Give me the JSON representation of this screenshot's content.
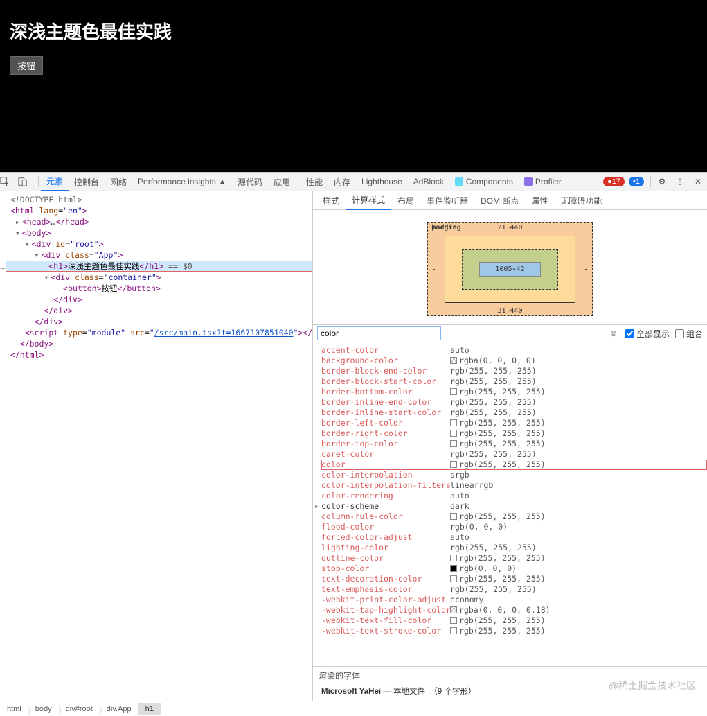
{
  "app": {
    "heading": "深浅主题色最佳实践",
    "button_label": "按钮"
  },
  "toolbar": {
    "tabs": [
      "元素",
      "控制台",
      "网络",
      "Performance insights ▲",
      "源代码",
      "应用",
      "性能",
      "内存",
      "Lighthouse",
      "AdBlock",
      "Components",
      "Profiler"
    ],
    "active_tab_index": 0,
    "error_count": "17",
    "message_count": "1"
  },
  "dom": {
    "doctype": "<!DOCTYPE html>",
    "html_open": "<html lang=\"en\">",
    "head": "<head>…</head>",
    "body_open": "<body>",
    "div_root": "<div id=\"root\">",
    "div_app": "<div class=\"App\">",
    "h1_line": "<h1>深浅主题色最佳实践</h1>",
    "eq0": " == $0",
    "div_container": "<div class=\"container\">",
    "button_line": "<button>按钮</button>",
    "div_close": "</div>",
    "script_prefix": "<script type=\"module\" src=\"",
    "script_src": "/src/main.tsx?t=1667107851040",
    "script_suffix": "\"></script>",
    "body_close": "</body>",
    "html_close": "</html>"
  },
  "styles_tabs": {
    "items": [
      "样式",
      "计算样式",
      "布局",
      "事件监听器",
      "DOM 断点",
      "属性",
      "无障碍功能"
    ],
    "active": 1
  },
  "boxmodel": {
    "margin_label": "margin",
    "border_label": "border",
    "padding_label": "padding",
    "margin_top": "21.440",
    "margin_bottom": "21.440",
    "margin_left": "-",
    "margin_right": "-",
    "border_all": "-",
    "padding_all": "-",
    "content": "1005×42"
  },
  "filter": {
    "value": "color",
    "show_all": "全部显示",
    "group": "组合"
  },
  "props": [
    {
      "name": "accent-color",
      "value": "auto",
      "swatch": null
    },
    {
      "name": "background-color",
      "value": "rgba(0, 0, 0, 0)",
      "swatch": "transparent"
    },
    {
      "name": "border-block-end-color",
      "value": "rgb(255, 255, 255)",
      "swatch": null
    },
    {
      "name": "border-block-start-color",
      "value": "rgb(255, 255, 255)",
      "swatch": null
    },
    {
      "name": "border-bottom-color",
      "value": "rgb(255, 255, 255)",
      "swatch": "#fff"
    },
    {
      "name": "border-inline-end-color",
      "value": "rgb(255, 255, 255)",
      "swatch": null
    },
    {
      "name": "border-inline-start-color",
      "value": "rgb(255, 255, 255)",
      "swatch": null
    },
    {
      "name": "border-left-color",
      "value": "rgb(255, 255, 255)",
      "swatch": "#fff"
    },
    {
      "name": "border-right-color",
      "value": "rgb(255, 255, 255)",
      "swatch": "#fff"
    },
    {
      "name": "border-top-color",
      "value": "rgb(255, 255, 255)",
      "swatch": "#fff"
    },
    {
      "name": "caret-color",
      "value": "rgb(255, 255, 255)",
      "swatch": null
    },
    {
      "name": "color",
      "value": "rgb(255, 255, 255)",
      "swatch": "#fff",
      "hl": true
    },
    {
      "name": "color-interpolation",
      "value": "srgb",
      "swatch": null
    },
    {
      "name": "color-interpolation-filters",
      "value": "linearrgb",
      "swatch": null
    },
    {
      "name": "color-rendering",
      "value": "auto",
      "swatch": null
    },
    {
      "name": "color-scheme",
      "value": "dark",
      "swatch": null,
      "bold": true,
      "arrow": true
    },
    {
      "name": "column-rule-color",
      "value": "rgb(255, 255, 255)",
      "swatch": "#fff"
    },
    {
      "name": "flood-color",
      "value": "rgb(0, 0, 0)",
      "swatch": null
    },
    {
      "name": "forced-color-adjust",
      "value": "auto",
      "swatch": null
    },
    {
      "name": "lighting-color",
      "value": "rgb(255, 255, 255)",
      "swatch": null
    },
    {
      "name": "outline-color",
      "value": "rgb(255, 255, 255)",
      "swatch": "#fff"
    },
    {
      "name": "stop-color",
      "value": "rgb(0, 0, 0)",
      "swatch": "#000"
    },
    {
      "name": "text-decoration-color",
      "value": "rgb(255, 255, 255)",
      "swatch": "#fff"
    },
    {
      "name": "text-emphasis-color",
      "value": "rgb(255, 255, 255)",
      "swatch": null
    },
    {
      "name": "-webkit-print-color-adjust",
      "value": "economy",
      "swatch": null
    },
    {
      "name": "-webkit-tap-highlight-color",
      "value": "rgba(0, 0, 0, 0.18)",
      "swatch": "transparent"
    },
    {
      "name": "-webkit-text-fill-color",
      "value": "rgb(255, 255, 255)",
      "swatch": "#fff"
    },
    {
      "name": "-webkit-text-stroke-color",
      "value": "rgb(255, 255, 255)",
      "swatch": "#fff"
    }
  ],
  "fonts": {
    "title": "渲染的字体",
    "family": "Microsoft YaHei",
    "dash": " — ",
    "source": "本地文件",
    "count": "（9 个字形）"
  },
  "breadcrumb": [
    "html",
    "body",
    "div#root",
    "div.App",
    "h1"
  ],
  "watermark": "@稀土掘金技术社区"
}
